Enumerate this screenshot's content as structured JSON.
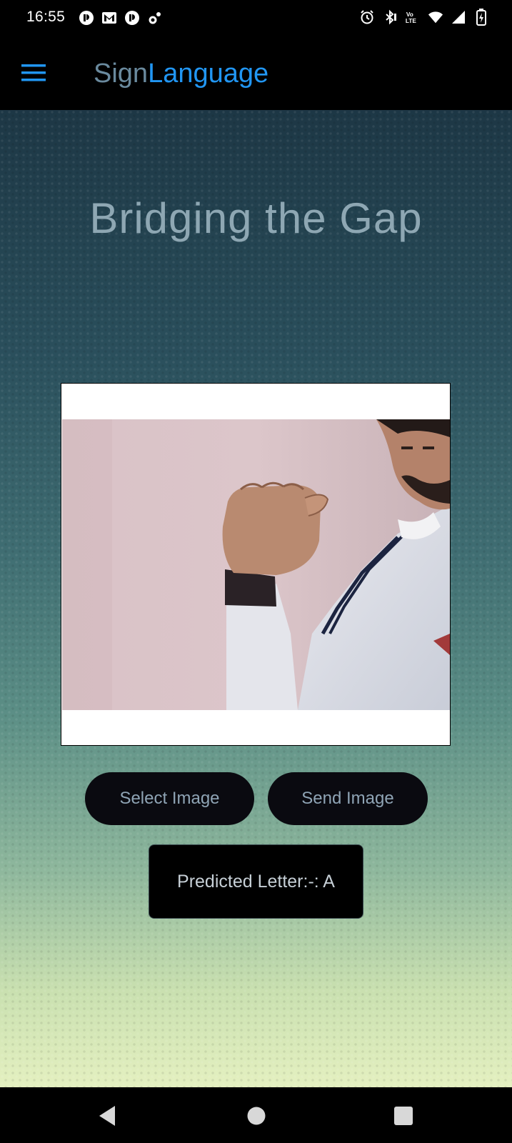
{
  "status_bar": {
    "time": "16:55",
    "left_icons": [
      "notification-app-icon",
      "gmail-icon",
      "notification-app-icon",
      "settings-sync-icon"
    ],
    "right_icons": [
      "alarm-icon",
      "bluetooth-icon",
      "volte-icon",
      "wifi-icon",
      "signal-icon",
      "battery-charging-icon"
    ],
    "volte_label": "Vo\nLTE"
  },
  "app_bar": {
    "title_part1": "Sign",
    "title_part2": "Language",
    "title_part1_color": "#6a8a9e",
    "title_part2_color": "#2196f3",
    "menu_icon": "hamburger-menu-icon"
  },
  "main": {
    "headline": "Bridging the Gap",
    "image_description": "photo-hand-sign",
    "select_button_label": "Select Image",
    "send_button_label": "Send Image",
    "prediction_text": "Predicted Letter:-: A"
  },
  "nav_bar": {
    "icons": [
      "back-icon",
      "home-icon",
      "recents-icon"
    ]
  },
  "colors": {
    "accent": "#2196f3",
    "gradient_top": "#1d3745",
    "gradient_bottom": "#e4f0c0",
    "button_bg": "#0a0a10",
    "button_text": "#8fa4b5"
  }
}
